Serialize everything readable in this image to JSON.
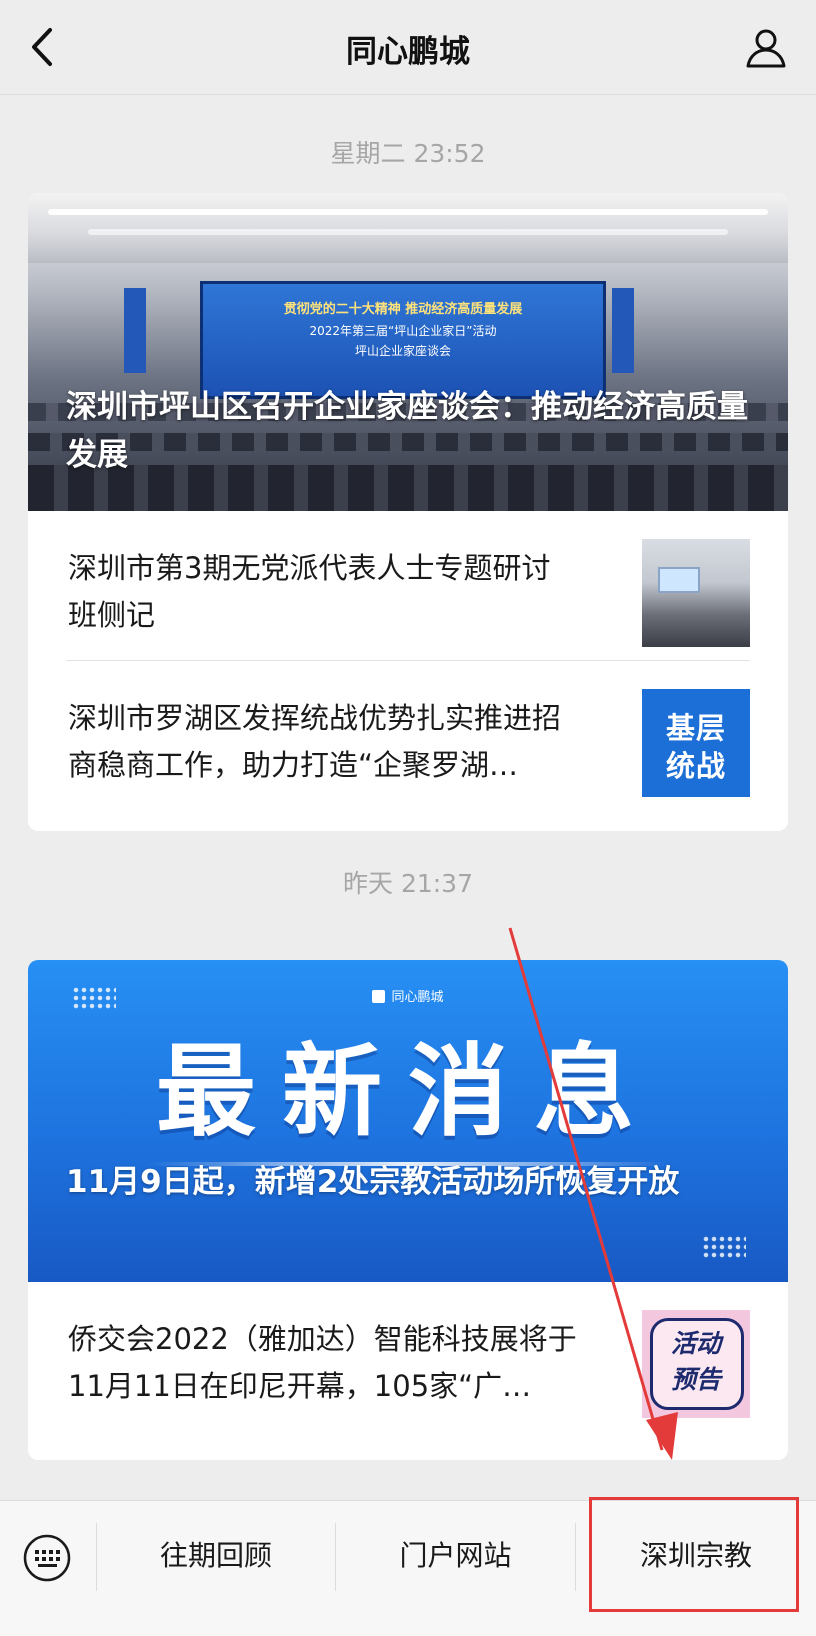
{
  "header": {
    "title": "同心鹏城"
  },
  "feed": [
    {
      "time": "星期二 23:52",
      "hero": {
        "caption": "深圳市坪山区召开企业家座谈会：推动经济高质量发展",
        "screen_line1": "贯彻党的二十大精神 推动经济高质量发展",
        "screen_line2": "2022年第三届“坪山企业家日”活动",
        "screen_line3": "坪山企业家座谈会"
      },
      "items": [
        {
          "title": "深圳市第3期无党派代表人士专题研讨班侧记",
          "thumb": "seminar-photo"
        },
        {
          "title": "深圳市罗湖区发挥统战优势扎实推进招商稳商工作，助力打造“企聚罗湖…",
          "thumb_text_1": "基层",
          "thumb_text_2": "统战"
        }
      ]
    },
    {
      "time": "昨天 21:37",
      "hero": {
        "brand": "同心鹏城",
        "big_text": "最新消息",
        "caption": "11月9日起，新增2处宗教活动场所恢复开放"
      },
      "items": [
        {
          "title": "侨交会2022（雅加达）智能科技展将于11月11日在印尼开幕，105家“广…",
          "thumb_text_1": "活动",
          "thumb_text_2": "预告"
        }
      ]
    }
  ],
  "bottom_menu": {
    "items": [
      "往期回顾",
      "门户网站",
      "深圳宗教"
    ]
  },
  "annotation": {
    "color": "#e33a3a"
  }
}
